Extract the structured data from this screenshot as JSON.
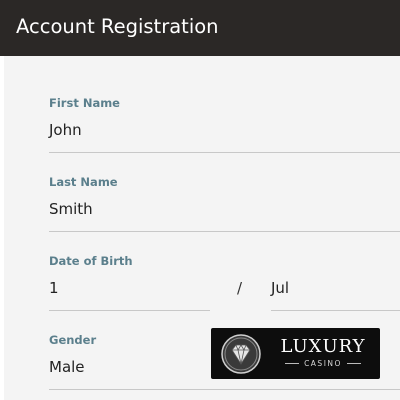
{
  "header": {
    "title": "Account Registration"
  },
  "form": {
    "first_name": {
      "label": "First Name",
      "value": "John"
    },
    "last_name": {
      "label": "Last Name",
      "value": "Smith"
    },
    "date_of_birth": {
      "label": "Date of Birth",
      "day": "1",
      "separator": "/",
      "month": "Jul"
    },
    "gender": {
      "label": "Gender",
      "value": "Male"
    }
  },
  "logo": {
    "name": "LUXURY",
    "tagline": "CASINO",
    "icon": "diamond-icon"
  },
  "colors": {
    "header_bg": "#2b2826",
    "label": "#5b7f8c",
    "form_bg": "#f4f4f4",
    "logo_bg": "#0d0d0d"
  }
}
